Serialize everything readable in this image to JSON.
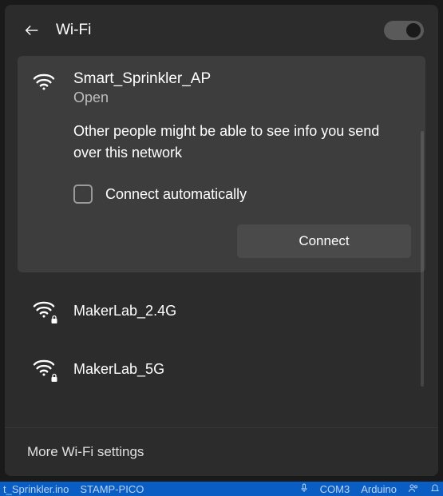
{
  "header": {
    "title": "Wi-Fi",
    "toggle_on": true
  },
  "selected_network": {
    "name": "Smart_Sprinkler_AP",
    "security": "Open",
    "warning": "Other people might be able to see info you send over this network",
    "auto_connect_label": "Connect automatically",
    "connect_label": "Connect"
  },
  "networks": [
    {
      "name": "MakerLab_2.4G",
      "secured": true
    },
    {
      "name": "MakerLab_5G",
      "secured": true
    }
  ],
  "more_settings_label": "More Wi-Fi settings",
  "taskbar": {
    "items": [
      "t_Sprinkler.ino",
      "STAMP-PICO",
      "COM3",
      "Arduino"
    ]
  }
}
